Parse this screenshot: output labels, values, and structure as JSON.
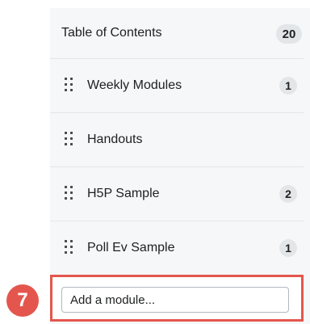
{
  "toc": {
    "title": "Table of Contents",
    "count": "20"
  },
  "modules": [
    {
      "label": "Weekly Modules",
      "count": "1"
    },
    {
      "label": "Handouts",
      "count": ""
    },
    {
      "label": "H5P Sample",
      "count": "2"
    },
    {
      "label": "Poll Ev Sample",
      "count": "1"
    }
  ],
  "add_module": {
    "placeholder": "Add a module..."
  },
  "callout": {
    "step": "7"
  },
  "colors": {
    "highlight": "#e4564d",
    "panel": "#f6f7f8",
    "badge": "#e3e6e9"
  }
}
